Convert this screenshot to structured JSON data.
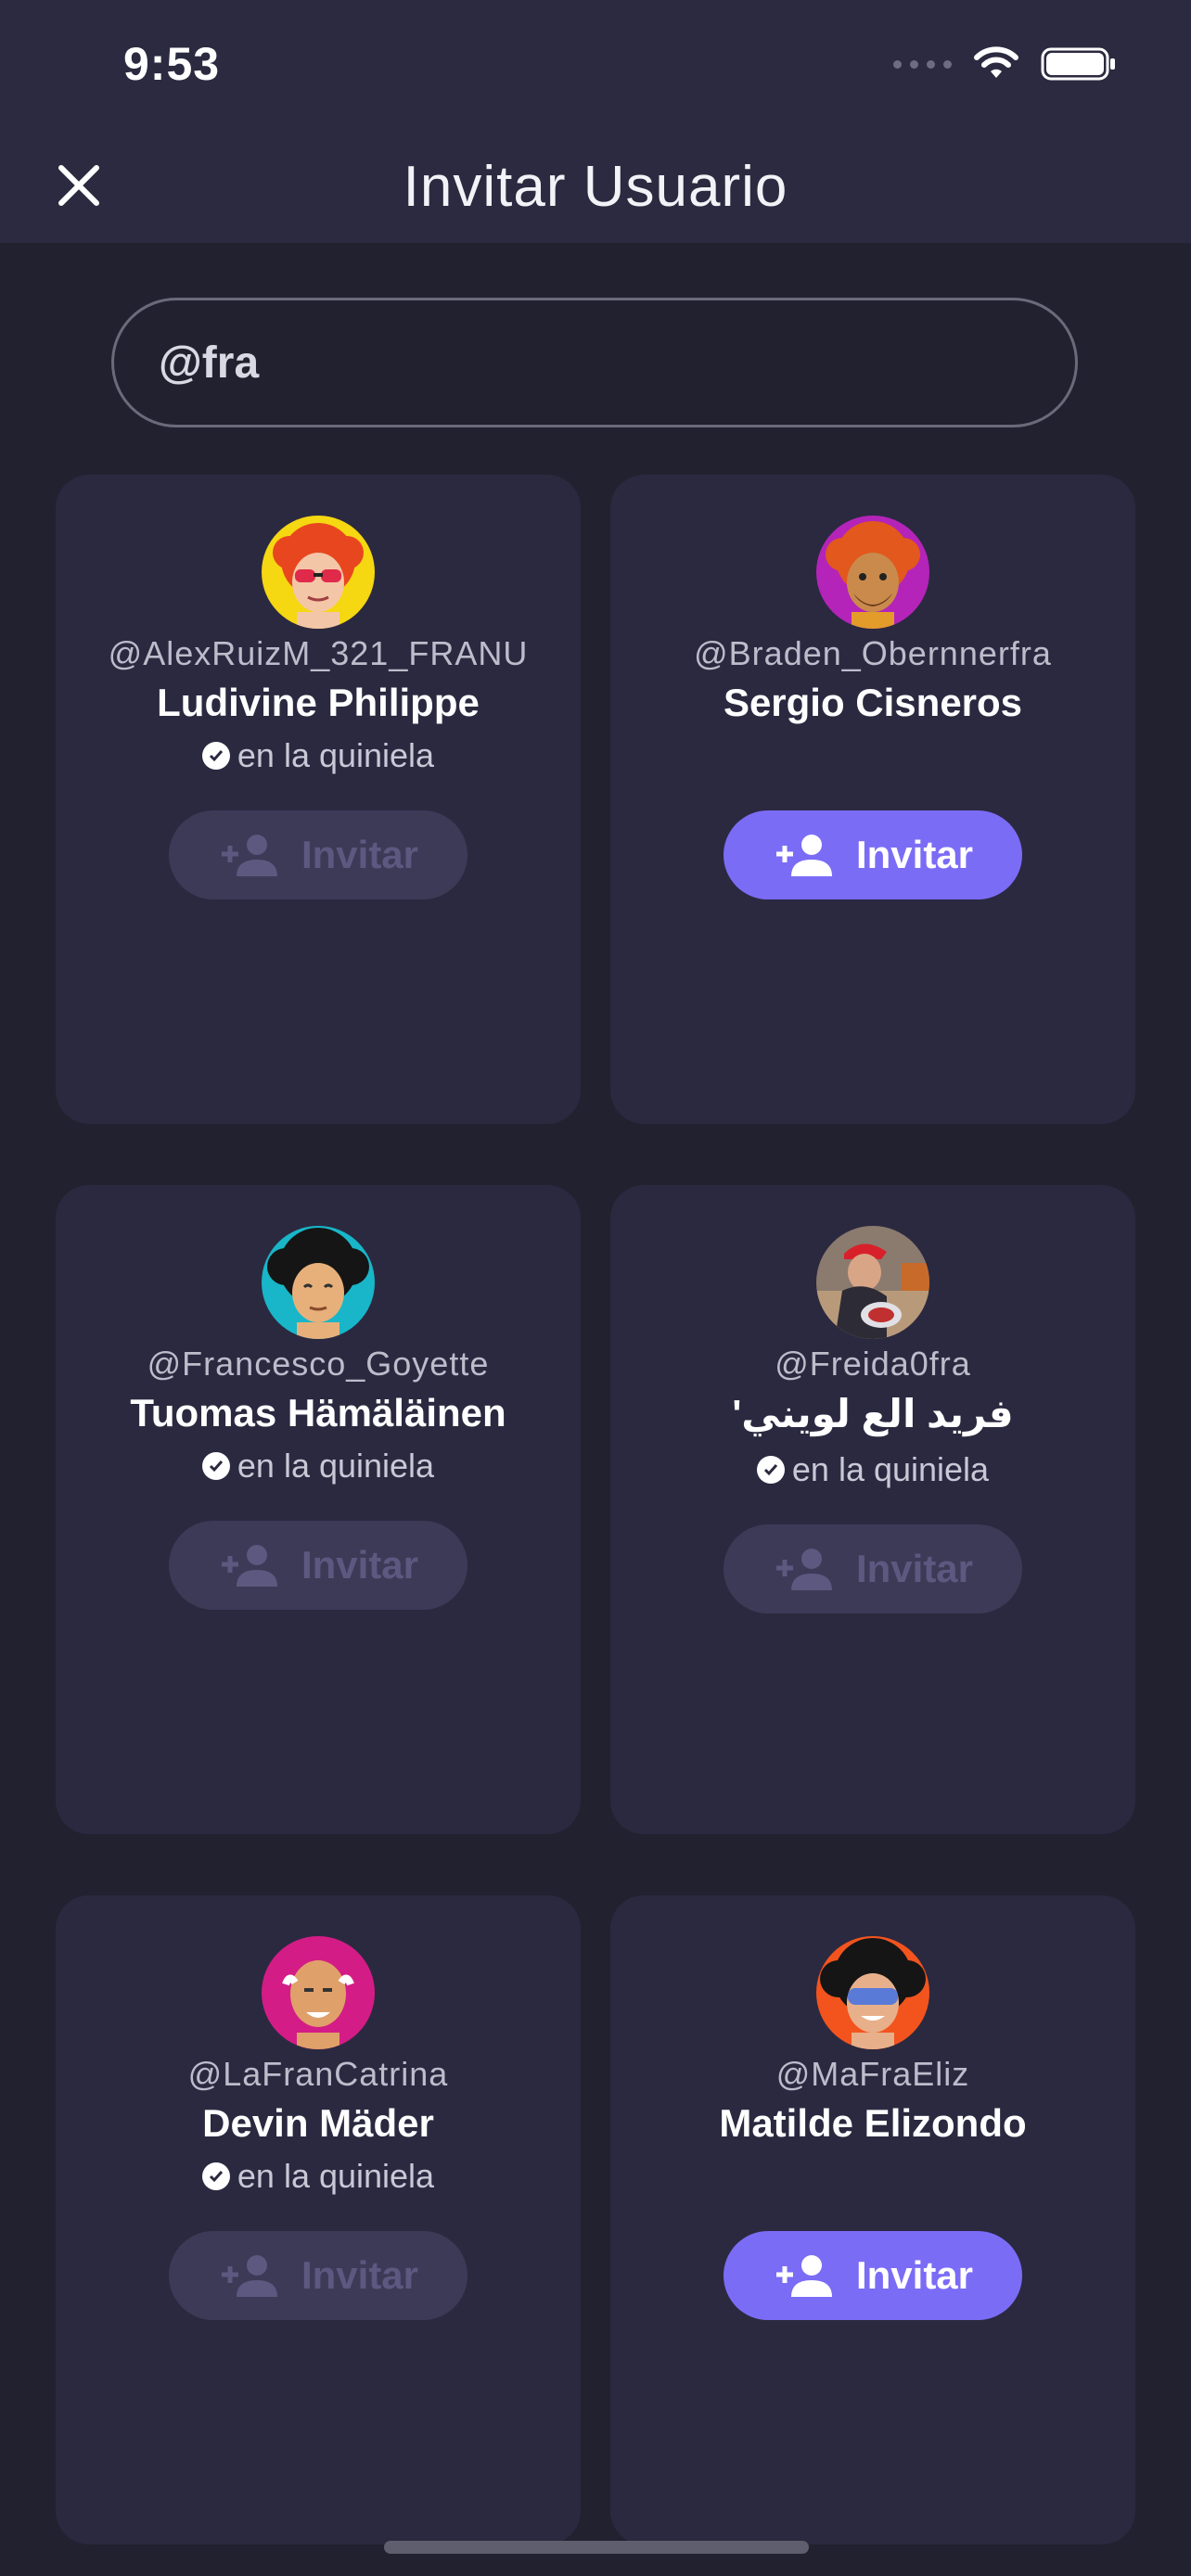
{
  "status_bar": {
    "time": "9:53"
  },
  "header": {
    "title": "Invitar Usuario"
  },
  "search": {
    "value": "@fra",
    "placeholder": ""
  },
  "colors": {
    "accent": "#7b6cf6",
    "background": "#22212f",
    "card": "#2b2940"
  },
  "users": [
    {
      "handle": "@AlexRuizM_321_FRANU",
      "name": "Ludivine Philippe",
      "status": "en la quiniela",
      "in_pool": true,
      "button_label": "Invitar",
      "avatar_icon": "avatar-red-curly-sunglasses-icon"
    },
    {
      "handle": "@Braden_Obernnerfra",
      "name": "Sergio Cisneros",
      "status": "",
      "in_pool": false,
      "button_label": "Invitar",
      "avatar_icon": "avatar-orange-beard-icon"
    },
    {
      "handle": "@Francesco_Goyette",
      "name": "Tuomas Hämäläinen",
      "status": "en la quiniela",
      "in_pool": true,
      "button_label": "Invitar",
      "avatar_icon": "avatar-black-afro-icon"
    },
    {
      "handle": "@Freida0fra",
      "name": "فريد الع لويني'",
      "status": "en la quiniela",
      "in_pool": true,
      "button_label": "Invitar",
      "avatar_icon": "avatar-photo-red-cap-icon"
    },
    {
      "handle": "@LaFranCatrina",
      "name": "Devin Mäder",
      "status": "en la quiniela",
      "in_pool": true,
      "button_label": "Invitar",
      "avatar_icon": "avatar-pink-bald-icon"
    },
    {
      "handle": "@MaFraEliz",
      "name": "Matilde Elizondo",
      "status": "",
      "in_pool": false,
      "button_label": "Invitar",
      "avatar_icon": "avatar-afro-visor-icon"
    }
  ]
}
